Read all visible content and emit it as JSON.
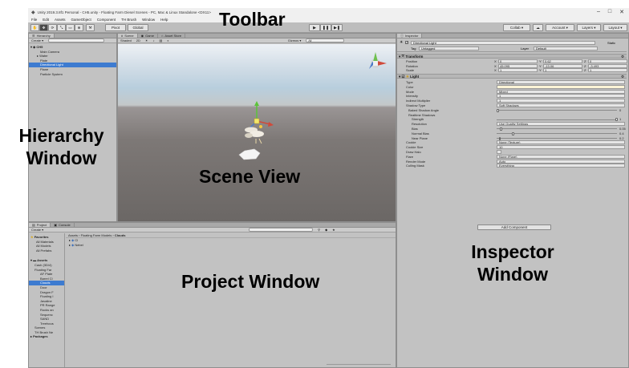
{
  "window": {
    "title": "Unity 2019.3.8f1 Personal - CH5.unity - Floating Farm Diesel Scenes - PC, Mac & Linux Standalone <DX11>",
    "controls": [
      "–",
      "□",
      "✕"
    ]
  },
  "menu": [
    "File",
    "Edit",
    "Assets",
    "GameObject",
    "Component",
    "TH Brush",
    "Window",
    "Help"
  ],
  "toolbar": {
    "pivot": "Pivot",
    "global": "Global",
    "play": "▶",
    "pause": "❚❚",
    "step": "▶❚",
    "collab": "Collab ▾",
    "account": "Account ▾",
    "layers": "Layers ▾",
    "layout": "Layout ▾"
  },
  "hierarchy": {
    "tab": "Hierarchy",
    "create": "Create ▾",
    "search": "",
    "scene": "CH5",
    "items": [
      "Main Camera",
      "Water",
      "Plate",
      "Directional Light",
      "Plane",
      "Particle System"
    ],
    "selected_index": 3
  },
  "scene": {
    "tabs": [
      "Scene",
      "Game",
      "Asset Store"
    ],
    "shading_mode": "Shaded",
    "mode_2d": "2D",
    "gizmos": "Gizmos ▾",
    "search": "All"
  },
  "project": {
    "tabs": [
      "Project",
      "Console"
    ],
    "create": "Create ▾",
    "breadcrumb": [
      "Assets",
      "Floating Farm Models",
      "Clouds"
    ],
    "favorites": [
      "Favorites",
      "All Materials",
      "All Models",
      "All Prefabs"
    ],
    "assets_root": "Assets",
    "tree": [
      "Cash (3D/4)",
      "Floating Far",
      "AF Plate",
      "Barrel Cl",
      "Clouds",
      "Door",
      "Dragon F",
      "Floating I",
      "Javaline",
      "PR Range",
      "Rocks an",
      "Sequenc",
      "SAND",
      "Treehous"
    ],
    "tree_extra": [
      "Scenes",
      "TH Brush Ne"
    ],
    "packages": "Packages",
    "folder_items": [
      "Cl",
      "Nebel"
    ]
  },
  "inspector": {
    "tab": "Inspector",
    "object_name": "Directional Light",
    "static_label": "Static",
    "tag_label": "Tag",
    "tag": "Untagged",
    "layer_label": "Layer",
    "layer": "Default",
    "transform": {
      "header": "Transform",
      "rows": [
        {
          "label": "Position",
          "x": "0",
          "y": "0.62",
          "z": "0"
        },
        {
          "label": "Rotation",
          "x": "45.095",
          "y": "-13.06",
          "z": "-3.493"
        },
        {
          "label": "Scale",
          "x": "1",
          "y": "1",
          "z": "1"
        }
      ]
    },
    "light": {
      "header": "Light",
      "rows": [
        {
          "label": "Type",
          "value": "Directional"
        },
        {
          "label": "Color",
          "value": ""
        },
        {
          "label": "Mode",
          "value": "Mixed"
        },
        {
          "label": "Intensity",
          "value": "1"
        },
        {
          "label": "Indirect Multiplier",
          "value": "1"
        },
        {
          "label": "Shadow Type",
          "value": "Soft Shadows"
        },
        {
          "label": "Baked Shadow Angle",
          "slider": 0,
          "num": "0"
        },
        {
          "label": "Realtime Shadows",
          "header": true
        },
        {
          "label": "Strength",
          "slider": 1,
          "num": "1"
        },
        {
          "label": "Resolution",
          "value": "Use Quality Settings"
        },
        {
          "label": "Bias",
          "slider": 0.03,
          "num": "0.05"
        },
        {
          "label": "Normal Bias",
          "slider": 0.13,
          "num": "0.4"
        },
        {
          "label": "Near Plane",
          "slider": 0.02,
          "num": "0.2"
        },
        {
          "label": "Cookie",
          "value": "None (Texture)"
        },
        {
          "label": "Cookie Size",
          "value": "10"
        },
        {
          "label": "Draw Halo",
          "value": ""
        },
        {
          "label": "Flare",
          "value": "None (Flare)"
        },
        {
          "label": "Render Mode",
          "value": "Auto"
        },
        {
          "label": "Culling Mask",
          "value": "Everything"
        }
      ]
    },
    "add_component": "Add Component"
  },
  "annotations": {
    "toolbar": "Toolbar",
    "hierarchy": [
      "Hierarchy",
      "Window"
    ],
    "scene": "Scene View",
    "project": "Project Window",
    "inspector": [
      "Inspector",
      "Window"
    ]
  }
}
